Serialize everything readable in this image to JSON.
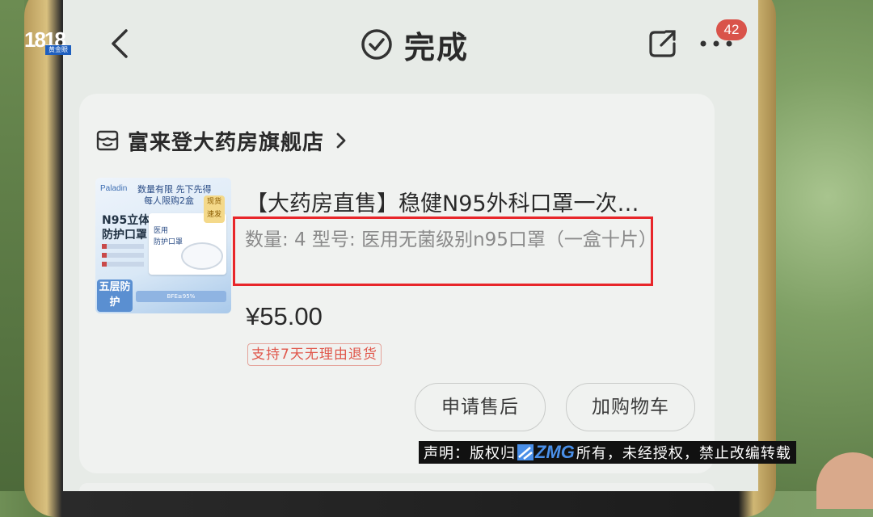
{
  "header": {
    "title": "完成",
    "notification_count": "42"
  },
  "store": {
    "name": "富来登大药房旗舰店"
  },
  "product": {
    "title": "【大药房直售】稳健N95外科口罩一次…",
    "spec_text": "数量: 4   型号: 医用无菌级别n95口罩（一盒十片）",
    "price": "¥55.00",
    "return_policy": "支持7天无理由退货",
    "image_texts": {
      "brand": "Paladin",
      "limited_line1": "数量有限  先下先得",
      "limited_line2": "每人限购2盒",
      "headline_1": "N95立体",
      "headline_2": "防护口罩",
      "tag": "现货速发",
      "box_line1": "医用",
      "box_line2": "防护口罩",
      "five_layer": "五层防护",
      "strip": "BFE≥95%"
    }
  },
  "actions": {
    "after_sale": "申请售后",
    "add_to_cart": "加购物车"
  },
  "overlay": {
    "channel_logo": "1818",
    "channel_sub": "黄金眼",
    "disclaimer_prefix": "声明：版权归",
    "zmg": "ZMG",
    "disclaimer_suffix": "所有，未经授权，禁止改编转载"
  },
  "colors": {
    "highlight_box": "#e8262a",
    "return_tag": "#e0574b",
    "badge": "#d9534a"
  }
}
